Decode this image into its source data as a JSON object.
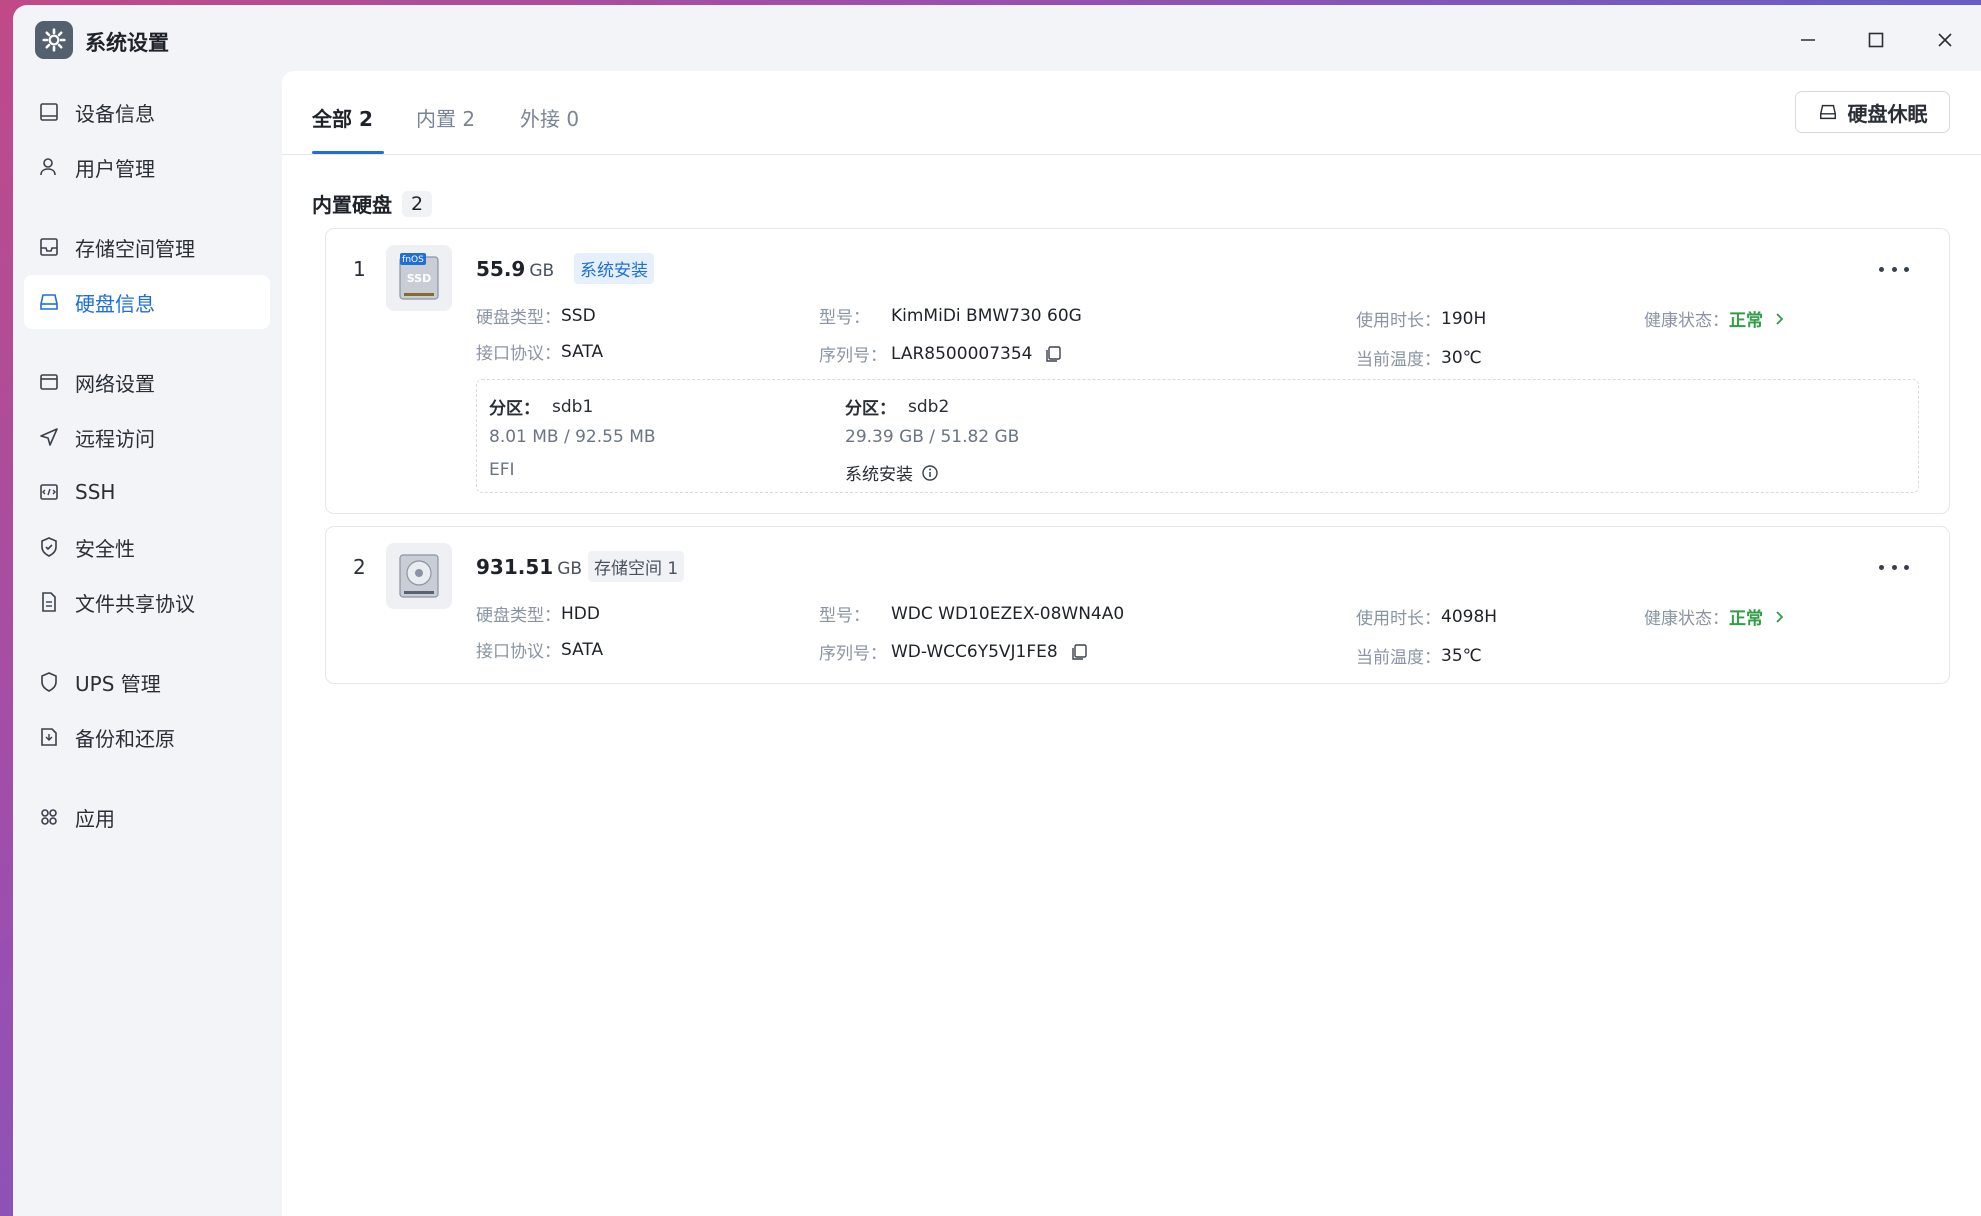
{
  "window": {
    "title": "系统设置"
  },
  "sidebar": {
    "items": [
      {
        "label": "设备信息",
        "icon": "device-icon"
      },
      {
        "label": "用户管理",
        "icon": "user-icon"
      },
      {
        "label": "存储空间管理",
        "icon": "storage-icon"
      },
      {
        "label": "硬盘信息",
        "icon": "disk-icon",
        "active": true
      },
      {
        "label": "网络设置",
        "icon": "network-icon"
      },
      {
        "label": "远程访问",
        "icon": "remote-icon"
      },
      {
        "label": "SSH",
        "icon": "terminal-icon"
      },
      {
        "label": "安全性",
        "icon": "shield-icon"
      },
      {
        "label": "文件共享协议",
        "icon": "file-share-icon"
      },
      {
        "label": "UPS 管理",
        "icon": "ups-icon"
      },
      {
        "label": "备份和还原",
        "icon": "backup-icon"
      },
      {
        "label": "应用",
        "icon": "apps-icon"
      }
    ]
  },
  "tabs": [
    {
      "label": "全部 2",
      "active": true
    },
    {
      "label": "内置 2"
    },
    {
      "label": "外接 0"
    }
  ],
  "toolbar": {
    "sleep_label": "硬盘休眠"
  },
  "section": {
    "title": "内置硬盘",
    "count": "2"
  },
  "disks": [
    {
      "index": "1",
      "capacity": "55.9",
      "unit": "GB",
      "tag": "系统安装",
      "img_label": "fnOS",
      "img_type": "SSD",
      "type_label": "硬盘类型：",
      "type_value": "SSD",
      "iface_label": "接口协议：",
      "iface_value": "SATA",
      "model_label": "型号：",
      "model_value": "KimMiDi BMW730 60G",
      "serial_label": "序列号：",
      "serial_value": "LAR8500007354",
      "uptime_label": "使用时长：",
      "uptime_value": "190H",
      "temp_label": "当前温度：",
      "temp_value": "30℃",
      "health_label": "健康状态：",
      "health_value": "正常",
      "partitions": [
        {
          "label": "分区：",
          "name": "sdb1",
          "usage": "8.01 MB / 92.55 MB",
          "desc": "EFI"
        },
        {
          "label": "分区：",
          "name": "sdb2",
          "usage": "29.39 GB / 51.82 GB",
          "desc": "系统安装"
        }
      ]
    },
    {
      "index": "2",
      "capacity": "931.51",
      "unit": "GB",
      "tag": "存储空间 1",
      "type_label": "硬盘类型：",
      "type_value": "HDD",
      "iface_label": "接口协议：",
      "iface_value": "SATA",
      "model_label": "型号：",
      "model_value": "WDC WD10EZEX-08WN4A0",
      "serial_label": "序列号：",
      "serial_value": "WD-WCC6Y5VJ1FE8",
      "uptime_label": "使用时长：",
      "uptime_value": "4098H",
      "temp_label": "当前温度：",
      "temp_value": "35℃",
      "health_label": "健康状态：",
      "health_value": "正常"
    }
  ],
  "colors": {
    "accent": "#1f6fd6",
    "ok": "#2f9e44"
  }
}
